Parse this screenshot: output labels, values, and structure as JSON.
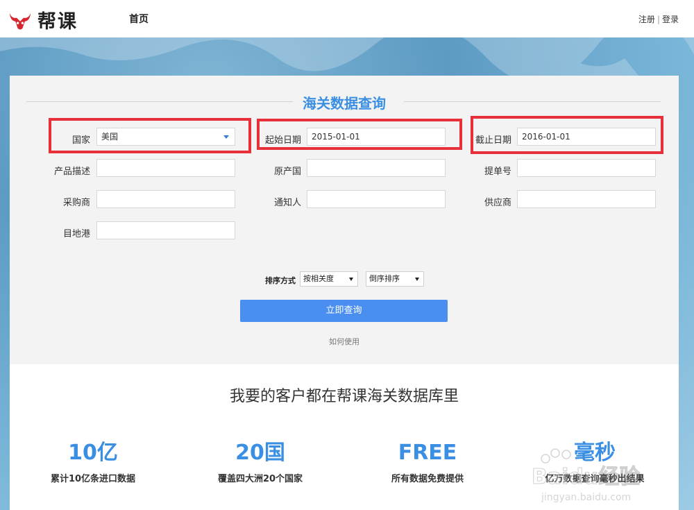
{
  "header": {
    "logo_text": "帮课",
    "nav_home": "首页",
    "register": "注册",
    "separator": "|",
    "login": "登录"
  },
  "panel": {
    "title": "海关数据查询",
    "fields": {
      "country": {
        "label": "国家",
        "value": "美国"
      },
      "start_date": {
        "label": "起始日期",
        "value": "2015-01-01"
      },
      "end_date": {
        "label": "截止日期",
        "value": "2016-01-01"
      },
      "product_desc": {
        "label": "产品描述",
        "value": ""
      },
      "origin_country": {
        "label": "原产国",
        "value": ""
      },
      "bill_no": {
        "label": "提单号",
        "value": ""
      },
      "buyer": {
        "label": "采购商",
        "value": ""
      },
      "notify_party": {
        "label": "通知人",
        "value": ""
      },
      "supplier": {
        "label": "供应商",
        "value": ""
      },
      "dest_port": {
        "label": "目地港",
        "value": ""
      }
    },
    "sort": {
      "label": "排序方式",
      "by": "按相关度",
      "order": "倒序排序"
    },
    "query_button": "立即查询",
    "howto_link": "如何使用"
  },
  "lower": {
    "title": "我要的客户都在帮课海关数据库里",
    "stats": [
      {
        "num": "10亿",
        "desc": "累计10亿条进口数据"
      },
      {
        "num": "20国",
        "desc": "覆盖四大洲20个国家"
      },
      {
        "num": "FREE",
        "desc": "所有数据免费提供"
      },
      {
        "num": "毫秒",
        "desc": "亿万数据查询毫秒出结果"
      }
    ]
  },
  "colors": {
    "accent": "#3a8fe2",
    "button": "#4a8fef",
    "highlight": "#e8303a",
    "logo_red": "#d7262d"
  },
  "watermark": {
    "brand": "Baidu经验",
    "sub": "jingyan.baidu.com"
  }
}
